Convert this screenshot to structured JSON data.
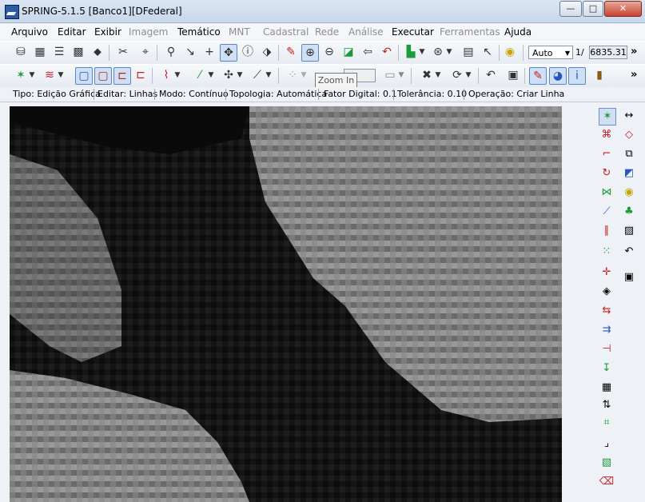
{
  "window": {
    "title": "SPRING-5.1.5 [Banco1][DFederal]",
    "controls": {
      "minimize": "—",
      "maximize": "□",
      "close": "✕"
    }
  },
  "menu": [
    {
      "label": "Arquivo",
      "enabled": true
    },
    {
      "label": "Editar",
      "enabled": true
    },
    {
      "label": "Exibir",
      "enabled": true
    },
    {
      "label": "Imagem",
      "enabled": false
    },
    {
      "label": "Temático",
      "enabled": true
    },
    {
      "label": "MNT",
      "enabled": false
    },
    {
      "label": "Cadastral",
      "enabled": false
    },
    {
      "label": "Rede",
      "enabled": false
    },
    {
      "label": "Análise",
      "enabled": false
    },
    {
      "label": "Executar",
      "enabled": true
    },
    {
      "label": "Ferramentas",
      "enabled": false
    },
    {
      "label": "Ajuda",
      "enabled": true
    }
  ],
  "toolbar1": {
    "scale_mode": "Auto",
    "scale_prefix": "1/",
    "scale_value": "6835.31",
    "overflow": "»"
  },
  "toolbar2": {
    "overflow": "»"
  },
  "tooltip": "Zoom In",
  "status": {
    "tipo": "Tipo: Edição Gráfica",
    "editar": "Editar: Linhas",
    "modo": "Modo: Contínuo",
    "topologia": "Topologia: Automática",
    "fator": "Fator Digital: 0.1",
    "tolerancia": "Tolerância: 0.10",
    "operacao": "Operação: Criar Linha"
  },
  "raster": {
    "description_colors": {
      "dark": "#0b0b0b",
      "light": "#9a9a9a"
    }
  }
}
